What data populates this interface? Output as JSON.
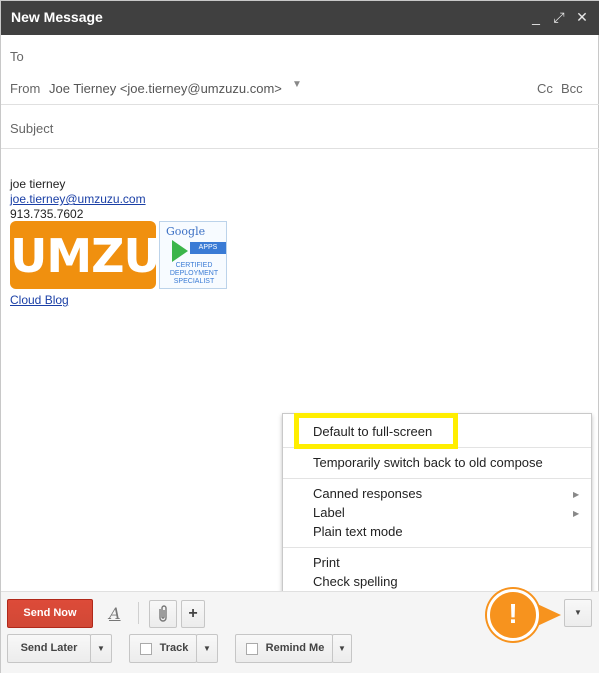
{
  "window": {
    "title": "New Message",
    "controls": {
      "minimize": "_",
      "expand": "⤢",
      "close": "✕"
    }
  },
  "header": {
    "to_label": "To",
    "from_label": "From",
    "from_value": "Joe Tierney <joe.tierney@umzuzu.com>",
    "cc_label": "Cc",
    "bcc_label": "Bcc",
    "subject_label": "Subject"
  },
  "signature": {
    "name": "joe tierney",
    "email": "joe.tierney@umzuzu.com",
    "phone": "913.735.7602",
    "logo_text": "UMZUZU",
    "badge": {
      "brand": "Google",
      "product": "APPS",
      "line1": "CERTIFIED",
      "line2": "DEPLOYMENT",
      "line3": "SPECIALIST"
    },
    "link": "Cloud Blog"
  },
  "menu": {
    "items": [
      {
        "label": "Default to full-screen"
      },
      {
        "label": "Temporarily switch back to old compose"
      },
      {
        "label": "Canned responses"
      },
      {
        "label": "Label"
      },
      {
        "label": "Plain text mode"
      },
      {
        "label": "Print"
      },
      {
        "label": "Check spelling"
      }
    ]
  },
  "toolbar": {
    "send_now": "Send Now",
    "format_glyph": "A",
    "plus_glyph": "+",
    "send_later": "Send Later",
    "track": "Track",
    "remind_me": "Remind Me"
  },
  "alert": {
    "glyph": "!"
  },
  "colors": {
    "titlebar": "#404040",
    "send_button": "#d14836",
    "highlight": "#ffee00",
    "alert": "#f7931e",
    "link": "#1a3fa6"
  }
}
